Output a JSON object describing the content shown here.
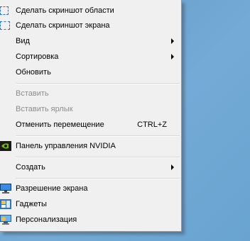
{
  "menu": {
    "items": [
      {
        "label": "Сделать скриншот области"
      },
      {
        "label": "Сделать скриншот экрана"
      },
      {
        "label": "Вид"
      },
      {
        "label": "Сортировка"
      },
      {
        "label": "Обновить"
      },
      {
        "label": "Вставить"
      },
      {
        "label": "Вставить ярлык"
      },
      {
        "label": "Отменить перемещение",
        "shortcut": "CTRL+Z"
      },
      {
        "label": "Панель управления NVIDIA"
      },
      {
        "label": "Создать"
      },
      {
        "label": "Разрешение экрана"
      },
      {
        "label": "Гаджеты"
      },
      {
        "label": "Персонализация"
      }
    ]
  },
  "colors": {
    "menu_bg": "#f0f0f0",
    "desktop": "#6ea4d0",
    "disabled_text": "#8d8d8d",
    "accent": "#2a72c9"
  },
  "icons": {
    "screenshot_area": "dashed-select-area-icon",
    "screenshot_screen": "dashed-select-screen-icon",
    "nvidia": "nvidia-icon",
    "screen_resolution": "monitor-icon",
    "gadgets": "gadgets-icon",
    "personalization": "personalization-icon"
  }
}
